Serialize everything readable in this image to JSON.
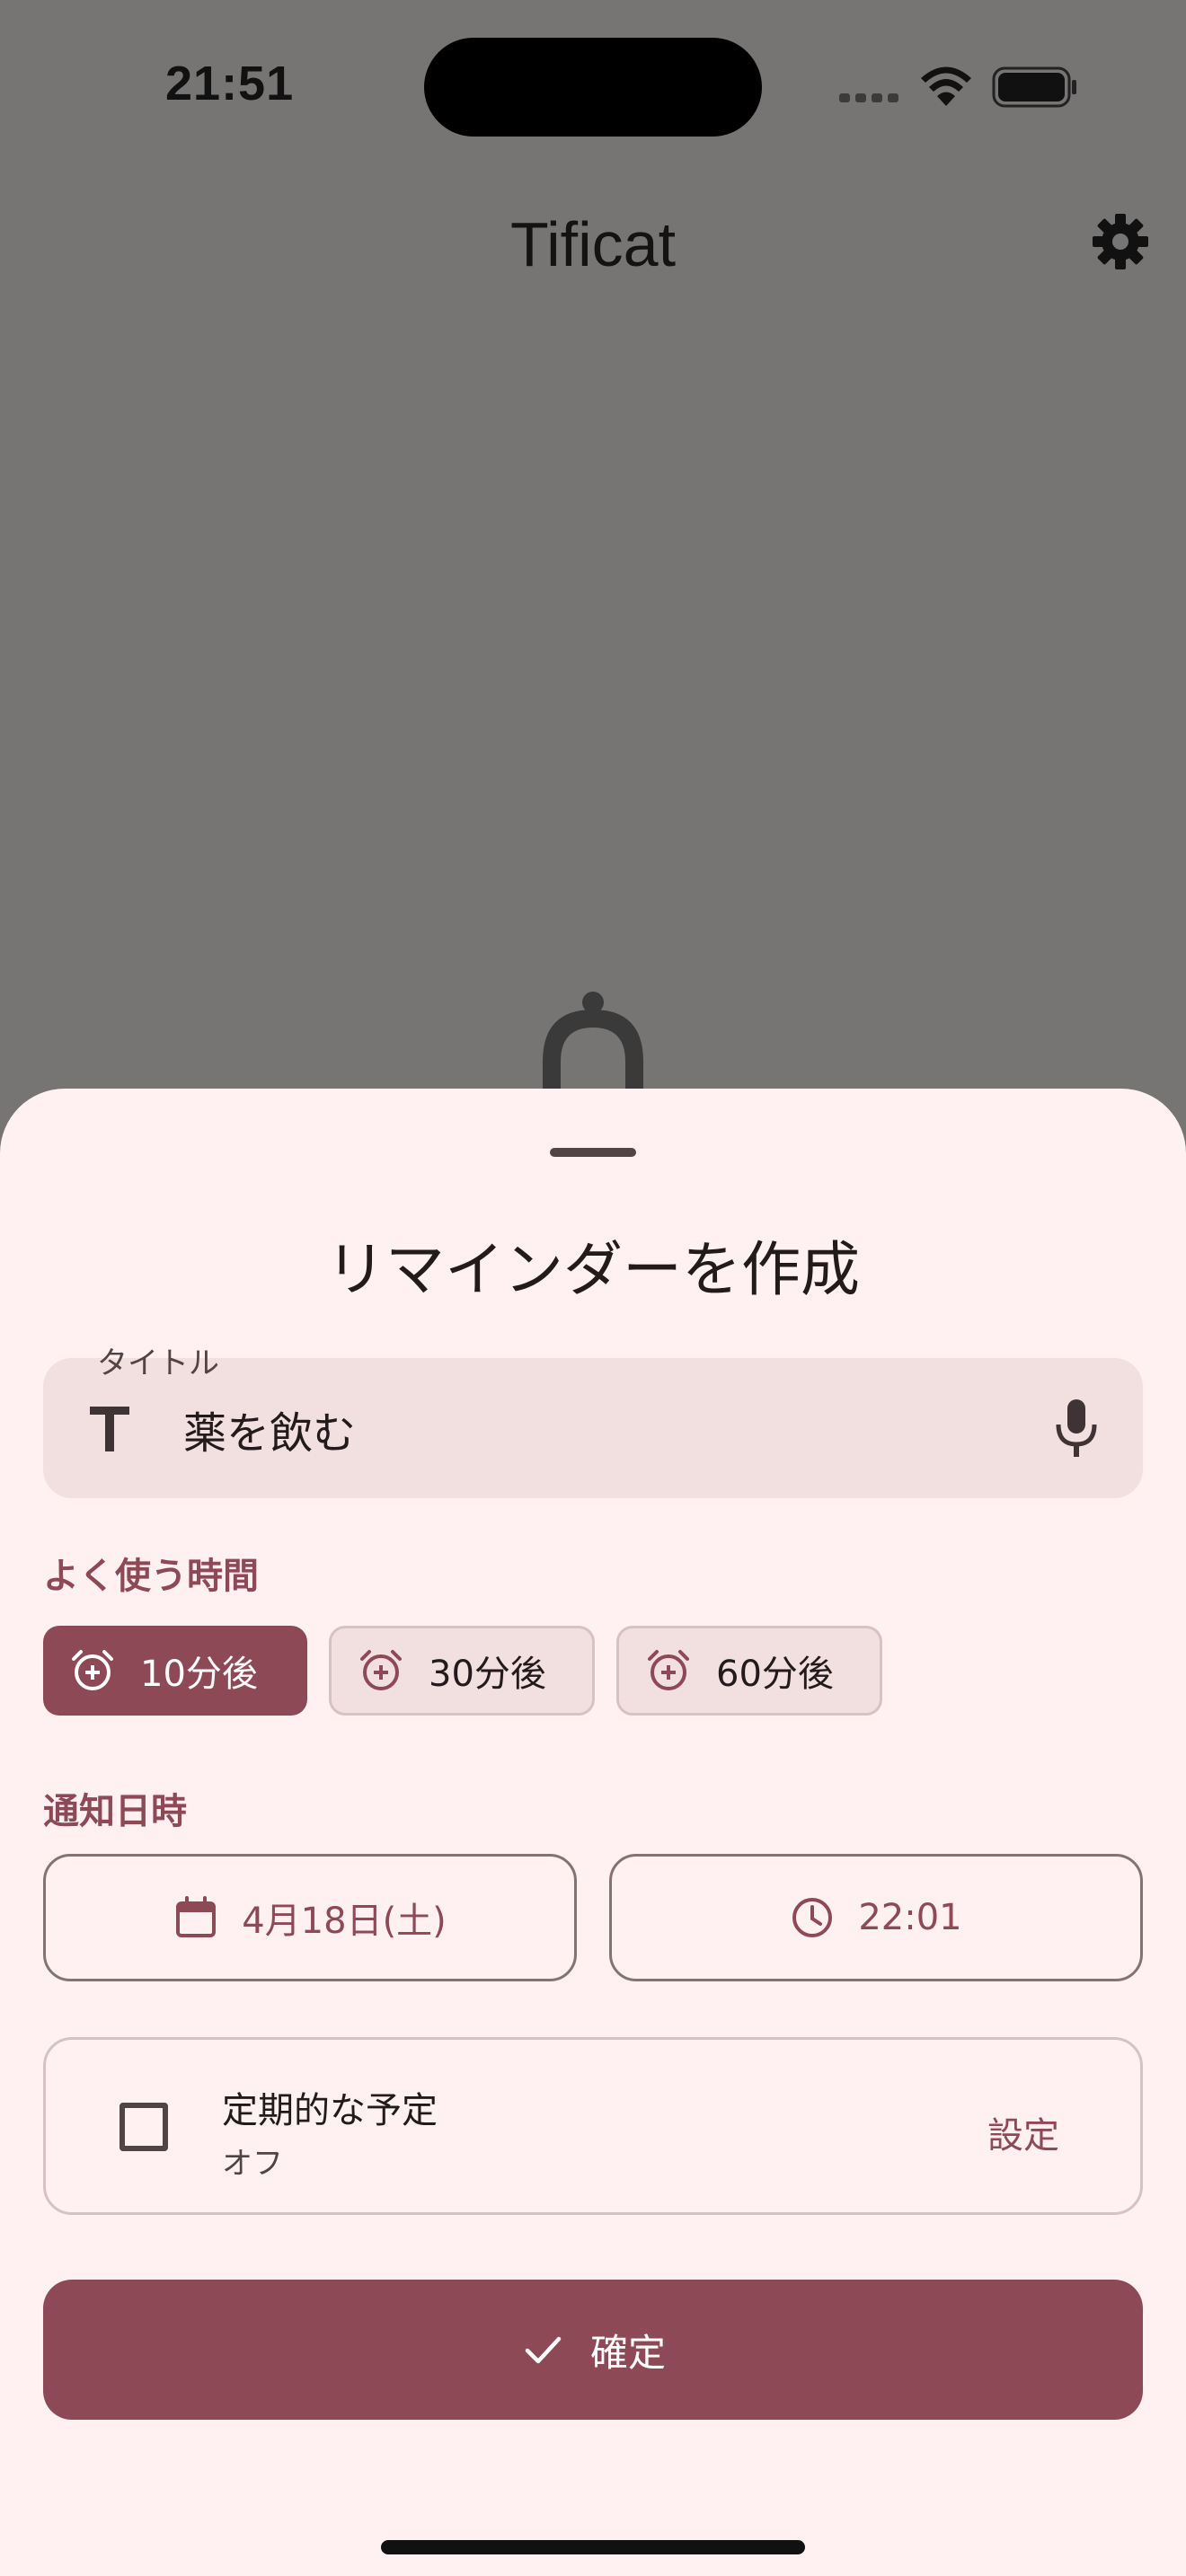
{
  "status_bar": {
    "time": "21:51"
  },
  "app_bar": {
    "title": "Tificat",
    "settings_icon": "gear-icon"
  },
  "sheet": {
    "title": "リマインダーを作成",
    "title_field": {
      "label": "タイトル",
      "value": "薬を飲む",
      "leading_icon": "text-icon",
      "trailing_icon": "mic-icon"
    },
    "quick_times": {
      "label": "よく使う時間",
      "chips": [
        {
          "label": "10分後",
          "selected": true,
          "icon": "alarm-add-icon"
        },
        {
          "label": "30分後",
          "selected": false,
          "icon": "alarm-add-icon"
        },
        {
          "label": "60分後",
          "selected": false,
          "icon": "alarm-add-icon"
        }
      ]
    },
    "notification": {
      "label": "通知日時",
      "date": "4月18日(土)",
      "time": "22:01",
      "date_icon": "calendar-icon",
      "time_icon": "clock-icon"
    },
    "recurring": {
      "title": "定期的な予定",
      "status": "オフ",
      "action": "設定",
      "checked": false
    },
    "confirm": {
      "label": "確定",
      "icon": "check-icon"
    }
  },
  "colors": {
    "primary": "#8e4956",
    "sheet_bg": "#fff1f1",
    "scrim": "#777474",
    "field_bg": "#f2dfe0"
  }
}
